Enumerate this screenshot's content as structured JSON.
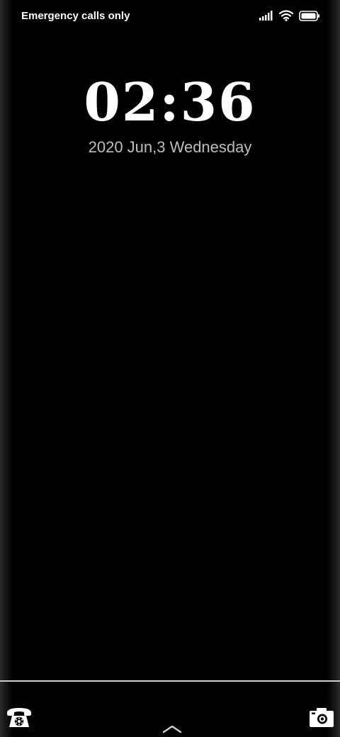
{
  "status_bar": {
    "carrier_text": "Emergency calls only",
    "icons": [
      "signal-icon",
      "wifi-icon",
      "battery-icon"
    ]
  },
  "lockscreen": {
    "time": "02:36",
    "date": "2020 Jun,3 Wednesday"
  },
  "shortcuts": {
    "left": "phone-icon",
    "right": "camera-icon",
    "center": "chevron-up-icon"
  },
  "colors": {
    "background": "#000000",
    "text_primary": "#ffffff",
    "text_secondary": "#bdbdbd",
    "divider": "#cfcfcf"
  }
}
